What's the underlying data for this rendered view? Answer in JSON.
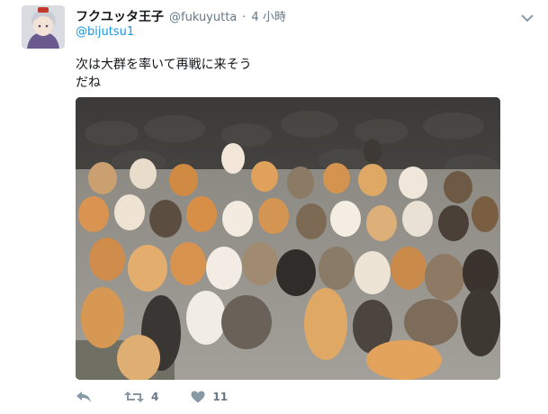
{
  "tweet": {
    "display_name": "フクユッタ王子",
    "handle": "@fukuyutta",
    "separator": "·",
    "time": "4 小時",
    "reply_to": "@bijutsu1",
    "text_line1": "次は大群を率いて再戦に来そう",
    "text_line2": "だね"
  },
  "actions": {
    "reply_icon": "reply-icon",
    "retweet_icon": "retweet-icon",
    "retweet_count": "4",
    "like_icon": "heart-icon",
    "like_count": "11"
  },
  "colors": {
    "link": "#1b95e0",
    "muted": "#657786",
    "text": "#14171a"
  }
}
